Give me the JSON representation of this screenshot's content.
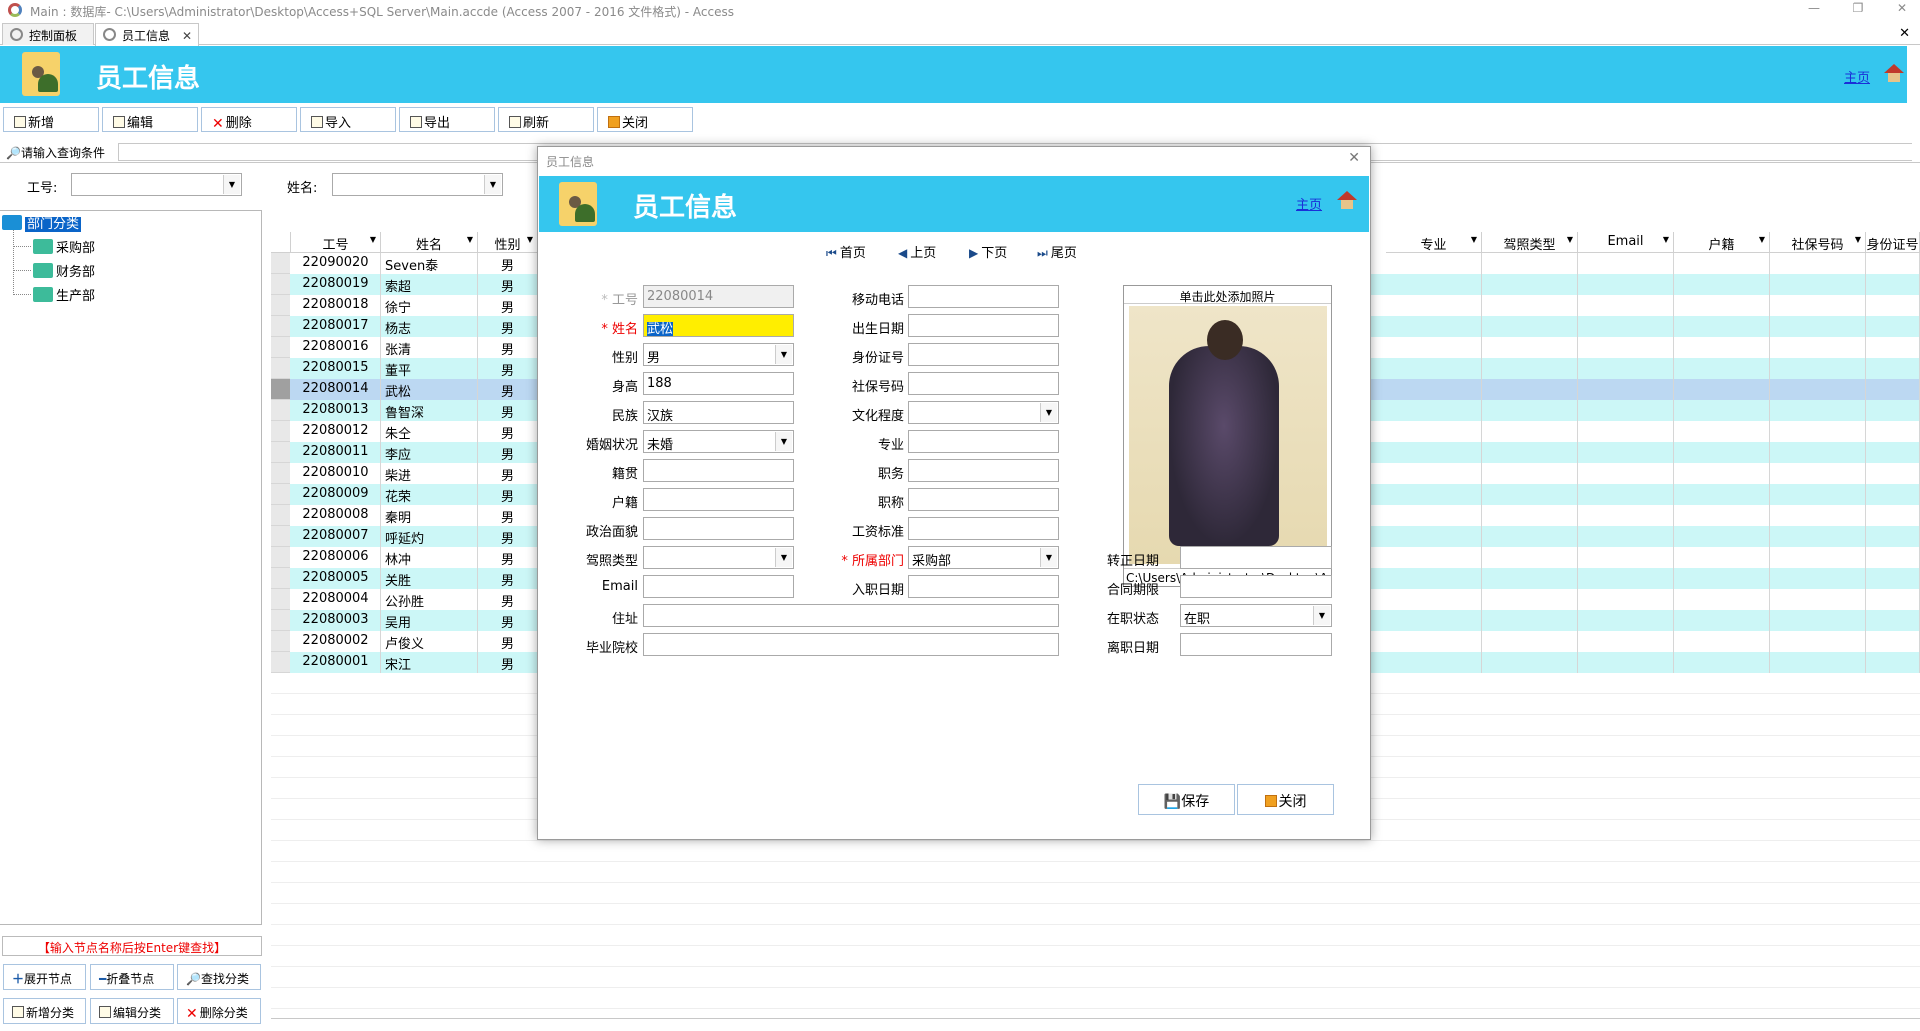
{
  "window": {
    "title": "Main : 数据库- C:\\Users\\Administrator\\Desktop\\Access+SQL Server\\Main.accde (Access 2007 - 2016 文件格式) - Access"
  },
  "tabs": [
    {
      "label": "控制面板"
    },
    {
      "label": "员工信息",
      "close": "✕"
    }
  ],
  "header": {
    "title": "员工信息",
    "home": "主页"
  },
  "toolbar": {
    "new": "新增",
    "edit": "编辑",
    "delete": "删除",
    "import": "导入",
    "export": "导出",
    "refresh": "刷新",
    "close": "关闭"
  },
  "query": {
    "label": "请输入查询条件",
    "emp_no_label": "工号:",
    "name_label": "姓名:"
  },
  "tree": {
    "root": "部门分类",
    "children": [
      "采购部",
      "财务部",
      "生产部"
    ],
    "hint": "【输入节点名称后按Enter键查找】"
  },
  "tree_buttons": {
    "expand": "展开节点",
    "collapse": "折叠节点",
    "find": "查找分类",
    "add": "新增分类",
    "edit": "编辑分类",
    "delete": "删除分类"
  },
  "grid": {
    "left_headers": [
      "工号",
      "姓名",
      "性别"
    ],
    "right_headers": [
      "专业",
      "驾照类型",
      "Email",
      "户籍",
      "社保号码",
      "身份证号"
    ],
    "rows": [
      [
        "22090020",
        "Seven泰",
        "男"
      ],
      [
        "22080019",
        "索超",
        "男"
      ],
      [
        "22080018",
        "徐宁",
        "男"
      ],
      [
        "22080017",
        "杨志",
        "男"
      ],
      [
        "22080016",
        "张清",
        "男"
      ],
      [
        "22080015",
        "董平",
        "男"
      ],
      [
        "22080014",
        "武松",
        "男"
      ],
      [
        "22080013",
        "鲁智深",
        "男"
      ],
      [
        "22080012",
        "朱仝",
        "男"
      ],
      [
        "22080011",
        "李应",
        "男"
      ],
      [
        "22080010",
        "柴进",
        "男"
      ],
      [
        "22080009",
        "花荣",
        "男"
      ],
      [
        "22080008",
        "秦明",
        "男"
      ],
      [
        "22080007",
        "呼延灼",
        "男"
      ],
      [
        "22080006",
        "林冲",
        "男"
      ],
      [
        "22080005",
        "关胜",
        "男"
      ],
      [
        "22080004",
        "公孙胜",
        "男"
      ],
      [
        "22080003",
        "吴用",
        "男"
      ],
      [
        "22080002",
        "卢俊义",
        "男"
      ],
      [
        "22080001",
        "宋江",
        "男"
      ]
    ],
    "selected_index": 6
  },
  "dialog": {
    "title": "员工信息",
    "header": "员工信息",
    "home": "主页",
    "nav": {
      "first": "首页",
      "prev": "上页",
      "next": "下页",
      "last": "尾页"
    },
    "fields": {
      "emp_no": {
        "label": "工号",
        "value": "22080014"
      },
      "name": {
        "label": "姓名",
        "value": "武松"
      },
      "gender": {
        "label": "性别",
        "value": "男"
      },
      "height": {
        "label": "身高",
        "value": "188"
      },
      "ethnic": {
        "label": "民族",
        "value": "汉族"
      },
      "marital": {
        "label": "婚姻状况",
        "value": "未婚"
      },
      "native": {
        "label": "籍贯",
        "value": ""
      },
      "household": {
        "label": "户籍",
        "value": ""
      },
      "political": {
        "label": "政治面貌",
        "value": ""
      },
      "license": {
        "label": "驾照类型",
        "value": ""
      },
      "email": {
        "label": "Email",
        "value": ""
      },
      "address": {
        "label": "住址",
        "value": ""
      },
      "school": {
        "label": "毕业院校",
        "value": ""
      },
      "mobile": {
        "label": "移动电话",
        "value": ""
      },
      "birth": {
        "label": "出生日期",
        "value": ""
      },
      "idcard": {
        "label": "身份证号",
        "value": ""
      },
      "social": {
        "label": "社保号码",
        "value": ""
      },
      "education": {
        "label": "文化程度",
        "value": ""
      },
      "major": {
        "label": "专业",
        "value": ""
      },
      "position": {
        "label": "职务",
        "value": ""
      },
      "title": {
        "label": "职称",
        "value": ""
      },
      "salary": {
        "label": "工资标准",
        "value": ""
      },
      "dept": {
        "label": "所属部门",
        "value": "采购部"
      },
      "hire": {
        "label": "入职日期",
        "value": ""
      },
      "regular": {
        "label": "转正日期",
        "value": ""
      },
      "contract": {
        "label": "合同期限",
        "value": ""
      },
      "status": {
        "label": "在职状态",
        "value": "在职"
      },
      "leave": {
        "label": "离职日期",
        "value": ""
      }
    },
    "photo": {
      "caption": "单击此处添加照片",
      "path": "C:\\Users\\Administrator\\Desktop\\Ac"
    },
    "save": "保存",
    "close": "关闭"
  }
}
